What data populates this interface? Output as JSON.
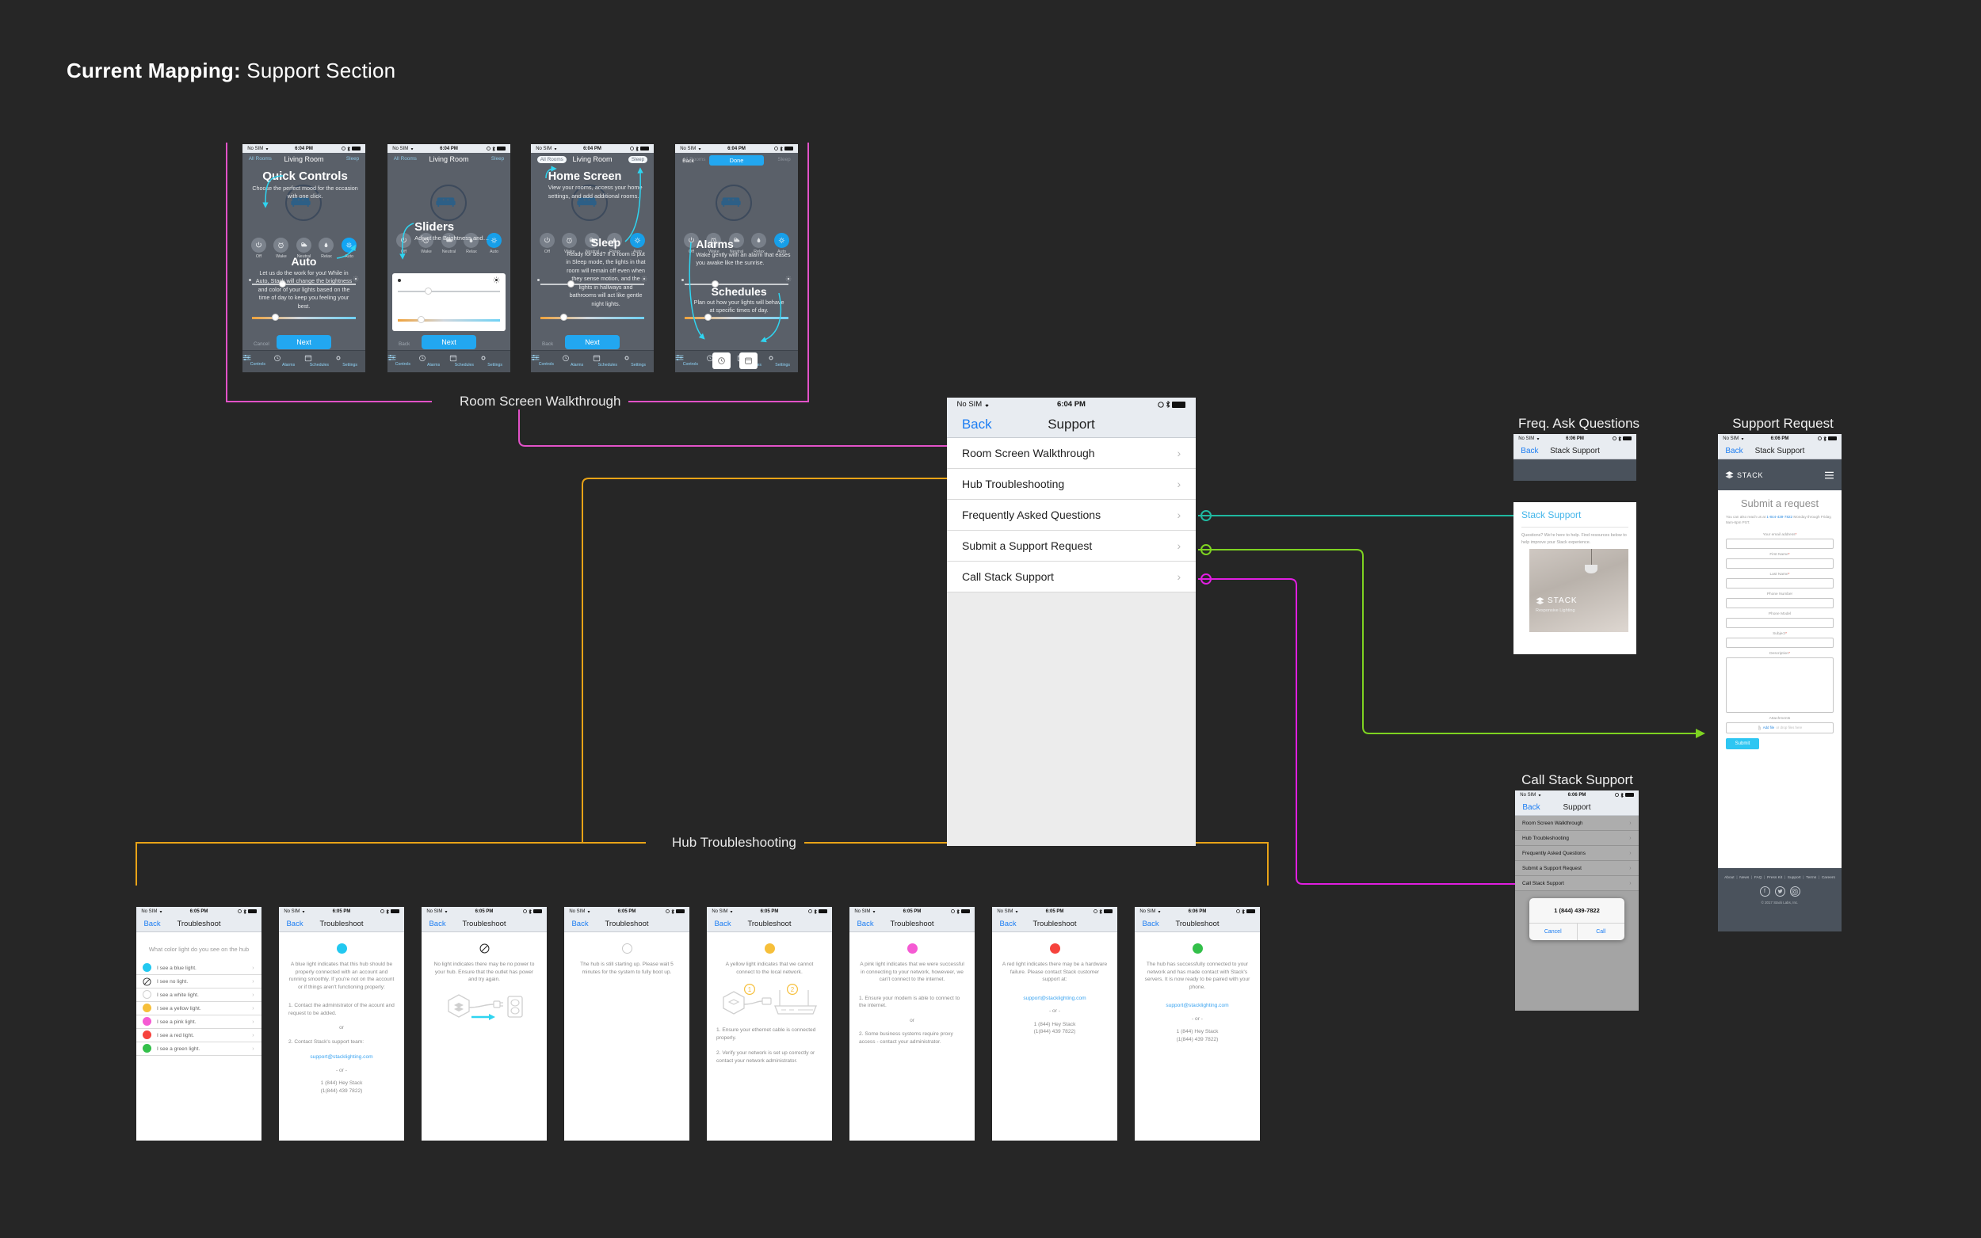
{
  "title": {
    "bold": "Current Mapping:",
    "normal": "Support Section"
  },
  "colors": {
    "background": "#262626",
    "walkthrough_connector": "#e252c8",
    "hub_connector": "#e8a317",
    "faq_connector": "#1fb9a0",
    "request_connector": "#7ed321",
    "call_connector": "#e01ee0",
    "ios_blue": "#1d7ef3",
    "stack_cyan": "#22a7f0"
  },
  "group_labels": {
    "walkthrough": "Room Screen Walkthrough",
    "hub": "Hub Troubleshooting",
    "faq": "Freq. Ask Questions",
    "request": "Support Request",
    "call": "Call Stack Support"
  },
  "status_bar": {
    "carrier": "No SIM",
    "time_604": "6:04 PM",
    "time_605": "6:05 PM",
    "time_606": "6:06 PM"
  },
  "support_screen": {
    "back": "Back",
    "title": "Support",
    "time": "6:04 PM",
    "rows": [
      "Room Screen Walkthrough",
      "Hub Troubleshooting",
      "Frequently Asked Questions",
      "Submit a Support Request",
      "Call Stack Support"
    ]
  },
  "walkthrough": {
    "room_title": "Living Room",
    "all_rooms": "All Rooms",
    "sleep": "Sleep",
    "back": "Back",
    "done": "Done",
    "next": "Next",
    "cancel": "Cancel",
    "moods": [
      "Off",
      "Wake",
      "Neutral",
      "Relax",
      "Auto"
    ],
    "tabs": [
      "Controls",
      "Alarms",
      "Schedules",
      "Settings"
    ],
    "screens": [
      {
        "headline_1": "Quick Controls",
        "body_1": "Choose the perfect mood for the occasion with one click.",
        "headline_2": "Auto",
        "body_2": "Let us do the work for you! While in Auto, Stack will change the brightness and color of your lights based on the time of day to keep you feeling your best."
      },
      {
        "headline_1": "Sliders",
        "body_1": "Adjust the Brightness and…"
      },
      {
        "headline_1": "Home Screen",
        "body_1": "View your rooms, access your home settings, and add additional rooms.",
        "headline_2": "Sleep",
        "body_2": "Ready for bed? If a room is put in Sleep mode, the lights in that room will remain off even when they sense motion, and the lights in hallways and bathrooms will act like gentle night lights."
      },
      {
        "headline_1": "Alarms",
        "body_1": "Wake gently with an alarm that eases you awake like the sunrise.",
        "headline_2": "Schedules",
        "body_2": "Plan out how your lights will behave at specific times of day."
      }
    ]
  },
  "troubleshoot": {
    "back": "Back",
    "title": "Troubleshoot",
    "question": "What color light do you see on the hub",
    "options": [
      {
        "label": "I see a blue light.",
        "color": "#22c8f0"
      },
      {
        "label": "I see no light.",
        "color": "none"
      },
      {
        "label": "I see a white light.",
        "color": "#ffffff"
      },
      {
        "label": "I see a yellow light.",
        "color": "#f6bf3a"
      },
      {
        "label": "I see a pink light.",
        "color": "#f55ad3"
      },
      {
        "label": "I see a red light.",
        "color": "#f6423c"
      },
      {
        "label": "I see a green light.",
        "color": "#33c04a"
      }
    ],
    "email": "support@stacklighting.com",
    "or_dashes": "- or -",
    "or": "or",
    "phone_words": "1 (844) Hey Stack",
    "phone_digits": "(1(844) 439 7822)",
    "screens": [
      {
        "time": "6:05 PM",
        "dot": "#22c8f0",
        "body": "A blue light indicates that this hub should be properly connected with an account and running smoothly. If you're not on the account or if things aren't functioning properly:",
        "step1": "1. Contact the administrator of the acount and request to be added.",
        "step2": "2. Contact Stack's support team:"
      },
      {
        "time": "6:05 PM",
        "dot": "none",
        "body": "No light indicates there may be no power to your hub. Ensure that the outlet has power and try again."
      },
      {
        "time": "6:05 PM",
        "dot": "#ffffff",
        "body": "The hub is still starting up. Please wait 5 minutes for the system to fully boot up."
      },
      {
        "time": "6:05 PM",
        "dot": "#f6bf3a",
        "body": "A yellow light indicates that we cannot connect to the local network.",
        "step1": "1. Ensure your ethernet cable is connected properly.",
        "step2": "2. Verify your network is set up correctly or contact your network administrator."
      },
      {
        "time": "6:05 PM",
        "dot": "#f55ad3",
        "body": "A pink light indicates that we were successful in connecting to your network, howeveer, we can't connect to the internet.",
        "step1": "1. Ensure your modem is able to connect to the internet.",
        "step2": "2. Some business systems require proxy access - contact your administrator."
      },
      {
        "time": "6:05 PM",
        "dot": "#f6423c",
        "body": "A red light indicates there may be a hardware failure. Please contact Stack customer support at:"
      },
      {
        "time": "6:06 PM",
        "dot": "#33c04a",
        "body": "The hub has successfully connected to your network and has made contact with Stack's servers. It is now ready to be paired with your phone."
      }
    ]
  },
  "faq_screen": {
    "time": "6:06 PM",
    "back": "Back",
    "title": "Stack Support",
    "heading": "Stack Support",
    "intro": "Questions? We're here to help. Find resources below to help improve your Stack experience.",
    "brand": "STACK",
    "tagline": "Responsive Lighting"
  },
  "request_screen": {
    "time": "6:06 PM",
    "back": "Back",
    "title": "Stack Support",
    "brand": "STACK",
    "heading": "Submit a request",
    "intro_pre": "You can also reach us at ",
    "intro_link": "1-844-439-7822",
    "intro_post": " Monday through Friday, 9am-6pm PST.",
    "fields": [
      {
        "label": "Your email address",
        "required": true,
        "type": "text"
      },
      {
        "label": "First Name",
        "required": true,
        "type": "text"
      },
      {
        "label": "Last Name",
        "required": true,
        "type": "text"
      },
      {
        "label": "Phone Number",
        "required": false,
        "type": "text"
      },
      {
        "label": "Phone Model",
        "required": false,
        "type": "text"
      },
      {
        "label": "Subject",
        "required": true,
        "type": "text"
      },
      {
        "label": "Description",
        "required": true,
        "type": "textarea"
      },
      {
        "label": "Attachments",
        "required": false,
        "type": "file"
      }
    ],
    "attach_link": "Add file",
    "attach_rest": " or drop files here",
    "submit": "Submit",
    "footer_links": [
      "About",
      "News",
      "FAQ",
      "Press Kit",
      "Support",
      "Terms",
      "Careers"
    ],
    "copyright": "© 2017 Stack Labs, Inc.",
    "socials": [
      "facebook-icon",
      "twitter-icon",
      "instagram-icon"
    ]
  },
  "call_screen": {
    "time": "6:06 PM",
    "back": "Back",
    "title": "Support",
    "rows": [
      "Room Screen Walkthrough",
      "Hub Troubleshooting",
      "Frequently Asked Questions",
      "Submit a Support Request",
      "Call Stack Support"
    ],
    "alert_number": "1 (844) 439-7822",
    "alert_cancel": "Cancel",
    "alert_call": "Call"
  }
}
